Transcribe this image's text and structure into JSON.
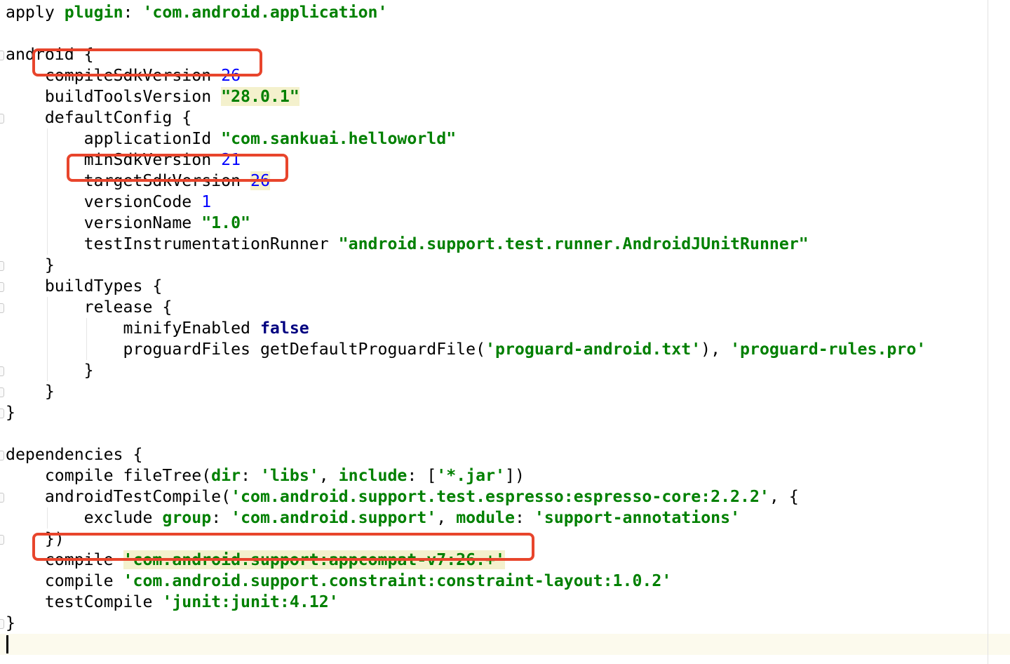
{
  "editor": {
    "lines": [
      [
        {
          "t": "apply "
        },
        {
          "t": "plugin",
          "c": "named-g"
        },
        {
          "t": ": "
        },
        {
          "t": "'com.android.application'",
          "c": "str"
        }
      ],
      [],
      [
        {
          "t": "android {"
        }
      ],
      [
        {
          "t": "    compileSdkVersion "
        },
        {
          "t": "26",
          "c": "num"
        }
      ],
      [
        {
          "t": "    buildToolsVersion "
        },
        {
          "t": "\"28.0.1\"",
          "c": "str hl"
        }
      ],
      [
        {
          "t": "    defaultConfig {"
        }
      ],
      [
        {
          "t": "        applicationId "
        },
        {
          "t": "\"com.sankuai.helloworld\"",
          "c": "str"
        }
      ],
      [
        {
          "t": "        minSdkVersion "
        },
        {
          "t": "21",
          "c": "num"
        }
      ],
      [
        {
          "t": "        targetSdkVersion "
        },
        {
          "t": "26",
          "c": "num hl"
        }
      ],
      [
        {
          "t": "        versionCode "
        },
        {
          "t": "1",
          "c": "num"
        }
      ],
      [
        {
          "t": "        versionName "
        },
        {
          "t": "\"1.0\"",
          "c": "str"
        }
      ],
      [
        {
          "t": "        testInstrumentationRunner "
        },
        {
          "t": "\"android.support.test.runner.AndroidJUnitRunner\"",
          "c": "str"
        }
      ],
      [
        {
          "t": "    }"
        }
      ],
      [
        {
          "t": "    buildTypes {"
        }
      ],
      [
        {
          "t": "        release {"
        }
      ],
      [
        {
          "t": "            minifyEnabled "
        },
        {
          "t": "false",
          "c": "kw"
        }
      ],
      [
        {
          "t": "            proguardFiles getDefaultProguardFile("
        },
        {
          "t": "'proguard-android.txt'",
          "c": "str"
        },
        {
          "t": "), "
        },
        {
          "t": "'proguard-rules.pro'",
          "c": "str"
        }
      ],
      [
        {
          "t": "        }"
        }
      ],
      [
        {
          "t": "    }"
        }
      ],
      [
        {
          "t": "}"
        }
      ],
      [],
      [
        {
          "t": "dependencies {"
        }
      ],
      [
        {
          "t": "    compile fileTree("
        },
        {
          "t": "dir",
          "c": "named-g"
        },
        {
          "t": ": "
        },
        {
          "t": "'libs'",
          "c": "str"
        },
        {
          "t": ", "
        },
        {
          "t": "include",
          "c": "named-g"
        },
        {
          "t": ": ["
        },
        {
          "t": "'*.jar'",
          "c": "str"
        },
        {
          "t": "])"
        }
      ],
      [
        {
          "t": "    androidTestCompile("
        },
        {
          "t": "'com.android.support.test.espresso:espresso-core:2.2.2'",
          "c": "str"
        },
        {
          "t": ", {"
        }
      ],
      [
        {
          "t": "        exclude "
        },
        {
          "t": "group",
          "c": "named-g"
        },
        {
          "t": ": "
        },
        {
          "t": "'com.android.support'",
          "c": "str"
        },
        {
          "t": ", "
        },
        {
          "t": "module",
          "c": "named-g"
        },
        {
          "t": ": "
        },
        {
          "t": "'support-annotations'",
          "c": "str"
        }
      ],
      [
        {
          "t": "    })"
        }
      ],
      [
        {
          "t": "    compile "
        },
        {
          "t": "'com.android.support:appcompat-v7:26.+'",
          "c": "str hl"
        }
      ],
      [
        {
          "t": "    compile "
        },
        {
          "t": "'com.android.support.constraint:constraint-layout:1.0.2'",
          "c": "str"
        }
      ],
      [
        {
          "t": "    testCompile "
        },
        {
          "t": "'junit:junit:4.12'",
          "c": "str"
        }
      ],
      [
        {
          "t": "}"
        }
      ],
      []
    ]
  },
  "colors": {
    "keyword": "#000080",
    "string": "#008000",
    "number": "#0000ff",
    "annotation_box": "#e8452c",
    "caret_line": "#fcfaed"
  },
  "annotations": {
    "boxed_line_indices": [
      3,
      8,
      26
    ]
  }
}
